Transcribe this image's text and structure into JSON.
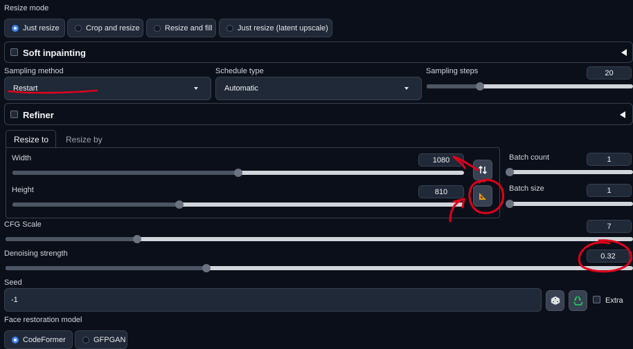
{
  "resize_mode": {
    "label": "Resize mode",
    "options": [
      "Just resize",
      "Crop and resize",
      "Resize and fill",
      "Just resize (latent upscale)"
    ],
    "selected": "Just resize"
  },
  "soft_inpainting": {
    "label": "Soft inpainting",
    "checked": false
  },
  "sampling_method": {
    "label": "Sampling method",
    "value": "Restart"
  },
  "schedule_type": {
    "label": "Schedule type",
    "value": "Automatic"
  },
  "sampling_steps": {
    "label": "Sampling steps",
    "value": "20",
    "level": 0.26
  },
  "refiner": {
    "label": "Refiner",
    "checked": false
  },
  "size_tabs": {
    "tabs": [
      "Resize to",
      "Resize by"
    ],
    "active": "Resize to"
  },
  "width": {
    "label": "Width",
    "value": "1080",
    "level": 0.5
  },
  "height": {
    "label": "Height",
    "value": "810",
    "level": 0.37
  },
  "batch_count": {
    "label": "Batch count",
    "value": "1",
    "level": 0.0
  },
  "batch_size": {
    "label": "Batch size",
    "value": "1",
    "level": 0.0
  },
  "cfg_scale": {
    "label": "CFG Scale",
    "value": "7",
    "level": 0.21
  },
  "denoising_strength": {
    "label": "Denoising strength",
    "value": "0.32",
    "level": 0.32
  },
  "seed": {
    "label": "Seed",
    "value": "-1"
  },
  "extra": {
    "label": "Extra",
    "checked": false
  },
  "face_restoration": {
    "label": "Face restoration model",
    "options": [
      "CodeFormer",
      "GFPGAN"
    ],
    "selected": "CodeFormer"
  },
  "icons": {
    "swap": "swap-dimensions-icon",
    "aspect": "aspect-ratio-icon",
    "dice": "dice-icon",
    "recycle": "recycle-icon",
    "collapse": "collapse-triangle-icon"
  },
  "annotation_color": "#e0001b"
}
